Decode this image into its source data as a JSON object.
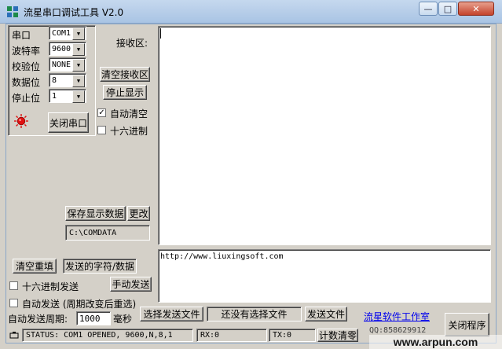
{
  "window": {
    "title": "流星串口调试工具 V2.0",
    "controls": {
      "minimize": "—",
      "maximize": "□",
      "close": "✕"
    }
  },
  "serial": {
    "port_label": "串口",
    "port_value": "COM1",
    "baud_label": "波特率",
    "baud_value": "9600",
    "parity_label": "校验位",
    "parity_value": "NONE",
    "databits_label": "数据位",
    "databits_value": "8",
    "stopbits_label": "停止位",
    "stopbits_value": "1",
    "close_port_button": "关闭串口",
    "indicator_color": "#e01010"
  },
  "receive": {
    "label": "接收区:",
    "clear_button": "清空接收区",
    "stop_display_button": "停止显示",
    "auto_clear_label": "自动清空",
    "auto_clear_checked": true,
    "hex_label": "十六进制",
    "hex_checked": false,
    "save_button": "保存显示数据",
    "change_button": "更改",
    "save_path": "C:\\COMDATA",
    "text": ""
  },
  "send": {
    "clear_resend_button": "清空重填",
    "sent_data_button": "发送的字符/数据",
    "hex_send_label": "十六进制发送",
    "hex_send_checked": false,
    "manual_send_button": "手动发送",
    "auto_send_label": "自动发送 (周期改变后重选)",
    "auto_send_checked": false,
    "period_label": "自动发送周期:",
    "period_value": "1000",
    "period_unit": "毫秒",
    "select_file_button": "选择发送文件",
    "file_status": "还没有选择文件",
    "send_file_button": "发送文件",
    "text": "http://www.liuxingsoft.com"
  },
  "footer": {
    "studio_link": "流星软件工作室",
    "qq": "QQ:858629912",
    "exit_button": "关闭程序"
  },
  "statusbar": {
    "status": "STATUS: COM1 OPENED, 9600,N,8,1",
    "rx": "RX:0",
    "tx": "TX:0",
    "reset_count_button": "计数清零"
  },
  "watermark": "www.arpun.com"
}
